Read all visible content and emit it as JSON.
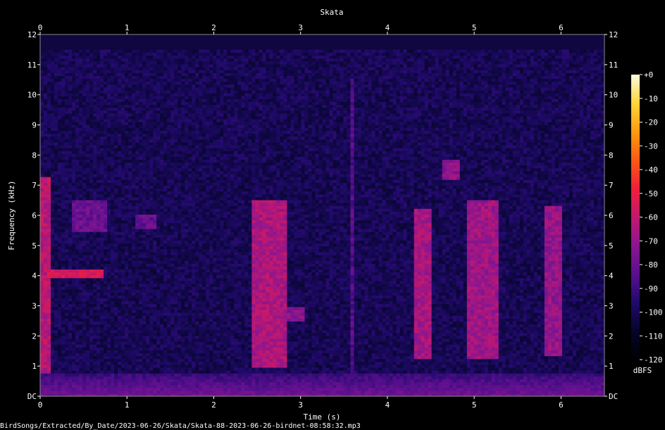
{
  "chart_data": {
    "type": "heatmap",
    "title": "Skata",
    "xlabel": "Time (s)",
    "ylabel": "Frequency (kHz)",
    "xlim": [
      0,
      6.5
    ],
    "ylim": [
      0,
      12
    ],
    "x_ticks": [
      "0",
      "1",
      "2",
      "3",
      "4",
      "5",
      "6"
    ],
    "y_ticks": [
      "DC",
      "1",
      "2",
      "3",
      "4",
      "5",
      "6",
      "7",
      "8",
      "9",
      "10",
      "11",
      "12"
    ],
    "colorbar": {
      "unit": "dBFS",
      "range": [
        -120,
        0
      ],
      "ticks": [
        "+0",
        "-10",
        "-20",
        "-30",
        "-40",
        "-50",
        "-60",
        "-70",
        "-80",
        "-90",
        "-100",
        "-110",
        "-120"
      ],
      "colors": [
        "#000000",
        "#05052a",
        "#200a6a",
        "#5a0f8e",
        "#8a1690",
        "#c2186e",
        "#ef1f3a",
        "#fb5a12",
        "#fd9a10",
        "#ffd43a",
        "#fffbe0"
      ]
    },
    "background_level": -100,
    "calls": [
      {
        "t0": 0.02,
        "t1": 0.12,
        "f0": 0.8,
        "f1": 7.3,
        "level": -62
      },
      {
        "t0": 0.1,
        "t1": 0.75,
        "f0": 3.9,
        "f1": 4.2,
        "level": -55
      },
      {
        "t0": 0.38,
        "t1": 0.78,
        "f0": 5.5,
        "f1": 6.5,
        "level": -80
      },
      {
        "t0": 1.1,
        "t1": 1.35,
        "f0": 5.6,
        "f1": 6.0,
        "level": -82
      },
      {
        "t0": 2.45,
        "t1": 2.85,
        "f0": 1.0,
        "f1": 6.5,
        "level": -65
      },
      {
        "t0": 2.7,
        "t1": 3.05,
        "f0": 2.5,
        "f1": 3.0,
        "level": -72
      },
      {
        "t0": 3.57,
        "t1": 3.61,
        "f0": 0.8,
        "f1": 10.5,
        "level": -85
      },
      {
        "t0": 4.3,
        "t1": 4.5,
        "f0": 1.2,
        "f1": 6.2,
        "level": -66
      },
      {
        "t0": 4.65,
        "t1": 4.85,
        "f0": 7.2,
        "f1": 7.9,
        "level": -72
      },
      {
        "t0": 4.9,
        "t1": 5.3,
        "f0": 1.2,
        "f1": 6.5,
        "level": -68
      },
      {
        "t0": 5.8,
        "t1": 6.0,
        "f0": 1.3,
        "f1": 6.3,
        "level": -70
      }
    ],
    "low_band": {
      "f0": 0.0,
      "f1": 0.8,
      "level": -78
    }
  },
  "footer": {
    "path": "BirdSongs/Extracted/By_Date/2023-06-26/Skata/Skata-88-2023-06-26-birdnet-08:58:32.mp3"
  }
}
